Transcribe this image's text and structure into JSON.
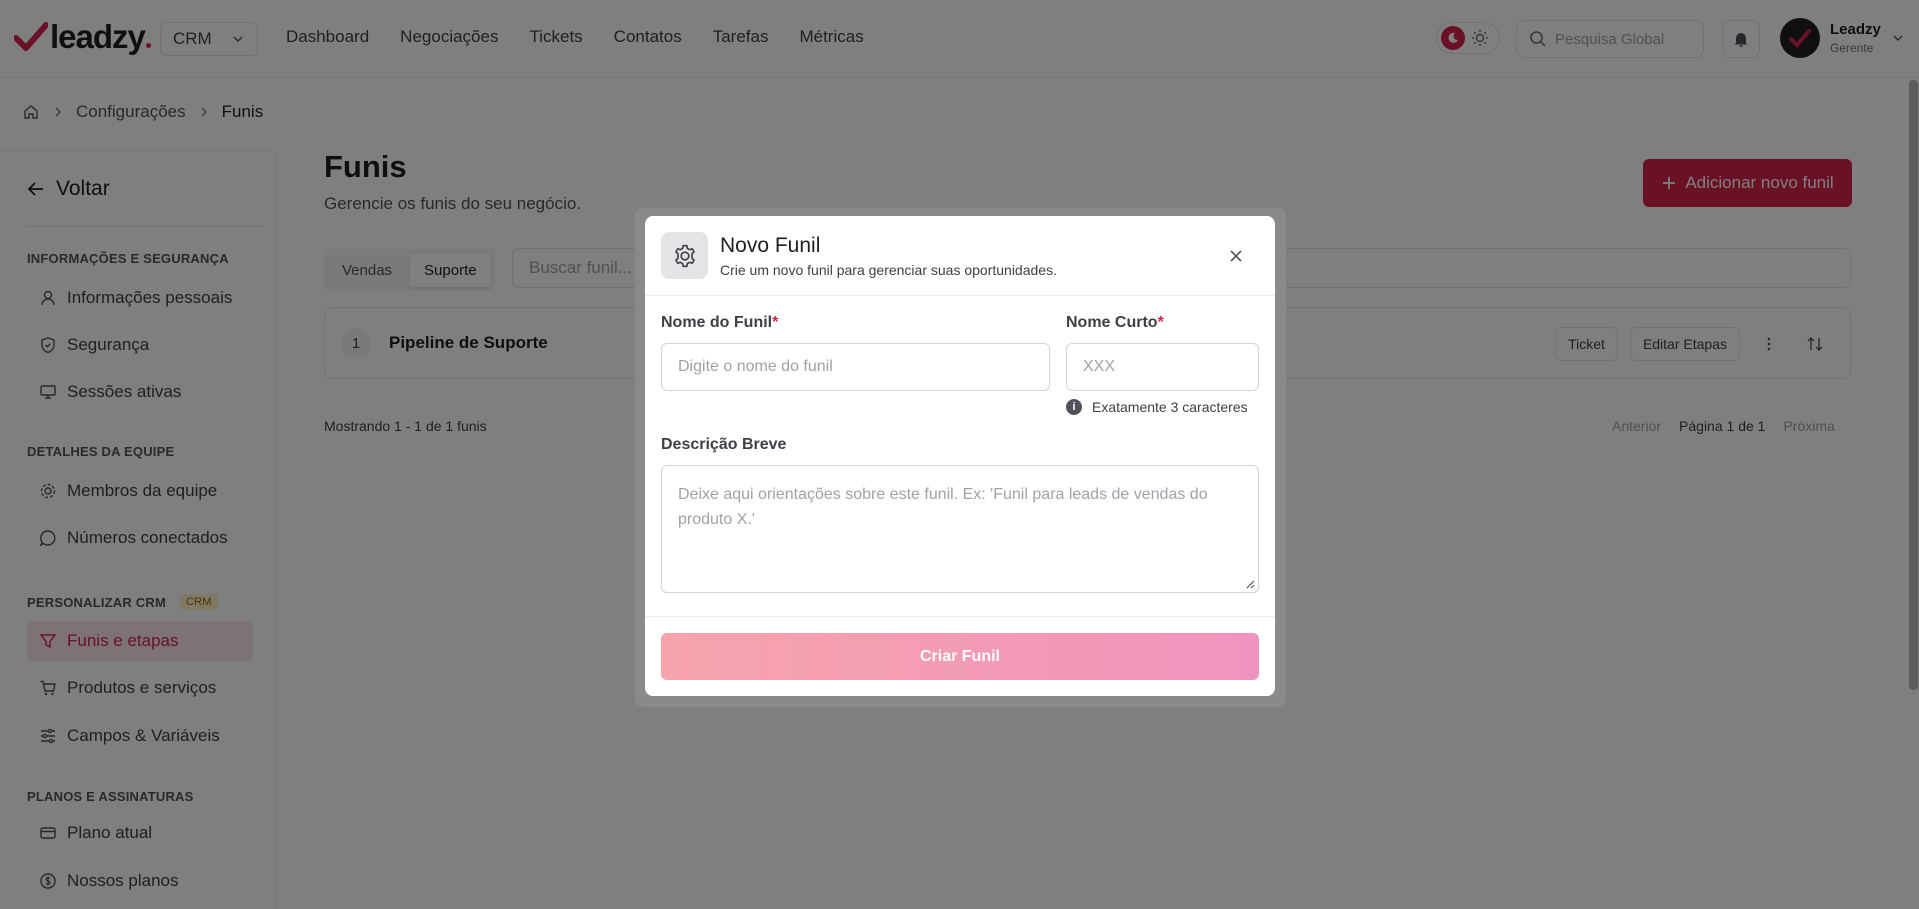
{
  "brand": {
    "name": "leadzy",
    "accent": "#d6234a"
  },
  "header": {
    "module_select": "CRM",
    "nav": [
      "Dashboard",
      "Negociações",
      "Tickets",
      "Contatos",
      "Tarefas",
      "Métricas"
    ],
    "search_placeholder": "Pesquisa Global",
    "user": {
      "name": "Leadzy",
      "role": "Gerente"
    }
  },
  "breadcrumb": {
    "items": [
      "Configurações",
      "Funis"
    ]
  },
  "sidebar": {
    "back_label": "Voltar",
    "sections": [
      {
        "title": "INFORMAÇÕES E SEGURANÇA",
        "items": [
          {
            "label": "Informações pessoais",
            "icon": "user-icon"
          },
          {
            "label": "Segurança",
            "icon": "shield-icon"
          },
          {
            "label": "Sessões ativas",
            "icon": "monitor-icon"
          }
        ]
      },
      {
        "title": "DETALHES DA EQUIPE",
        "items": [
          {
            "label": "Membros da equipe",
            "icon": "users-icon"
          },
          {
            "label": "Números conectados",
            "icon": "whatsapp-icon"
          }
        ]
      },
      {
        "title": "PERSONALIZAR CRM",
        "badge": "CRM",
        "items": [
          {
            "label": "Funis e etapas",
            "icon": "filter-icon",
            "active": true
          },
          {
            "label": "Produtos e serviços",
            "icon": "cart-icon"
          },
          {
            "label": "Campos & Variáveis",
            "icon": "sliders-icon"
          }
        ]
      },
      {
        "title": "PLANOS E ASSINATURAS",
        "items": [
          {
            "label": "Plano atual",
            "icon": "credit-card-icon"
          },
          {
            "label": "Nossos planos",
            "icon": "dollar-icon"
          }
        ]
      }
    ]
  },
  "main": {
    "title": "Funis",
    "subtitle": "Gerencie os funis do seu negócio.",
    "add_button": "Adicionar novo funil",
    "tabs": [
      "Vendas",
      "Suporte"
    ],
    "active_tab": "Suporte",
    "search_placeholder": "Buscar funil...",
    "funnels": [
      {
        "index": "1",
        "name": "Pipeline de Suporte",
        "type_badge": "Ticket",
        "edit_label": "Editar Etapas"
      }
    ],
    "showing_text": "Mostrando 1 - 1 de 1 funis",
    "pagination": {
      "prev": "Anterior",
      "page": "Página 1 de 1",
      "next": "Próxima"
    }
  },
  "modal": {
    "title": "Novo Funil",
    "subtitle": "Crie um novo funil para gerenciar suas oportunidades.",
    "name_label": "Nome do Funil",
    "name_placeholder": "Digite o nome do funil",
    "short_label": "Nome Curto",
    "short_placeholder": "XXX",
    "short_hint": "Exatamente 3 caracteres",
    "desc_label": "Descrição Breve",
    "desc_placeholder": "Deixe aqui orientações sobre este funil. Ex: 'Funil para leads de vendas do produto X.'",
    "submit": "Criar Funil",
    "required_mark": "*"
  }
}
